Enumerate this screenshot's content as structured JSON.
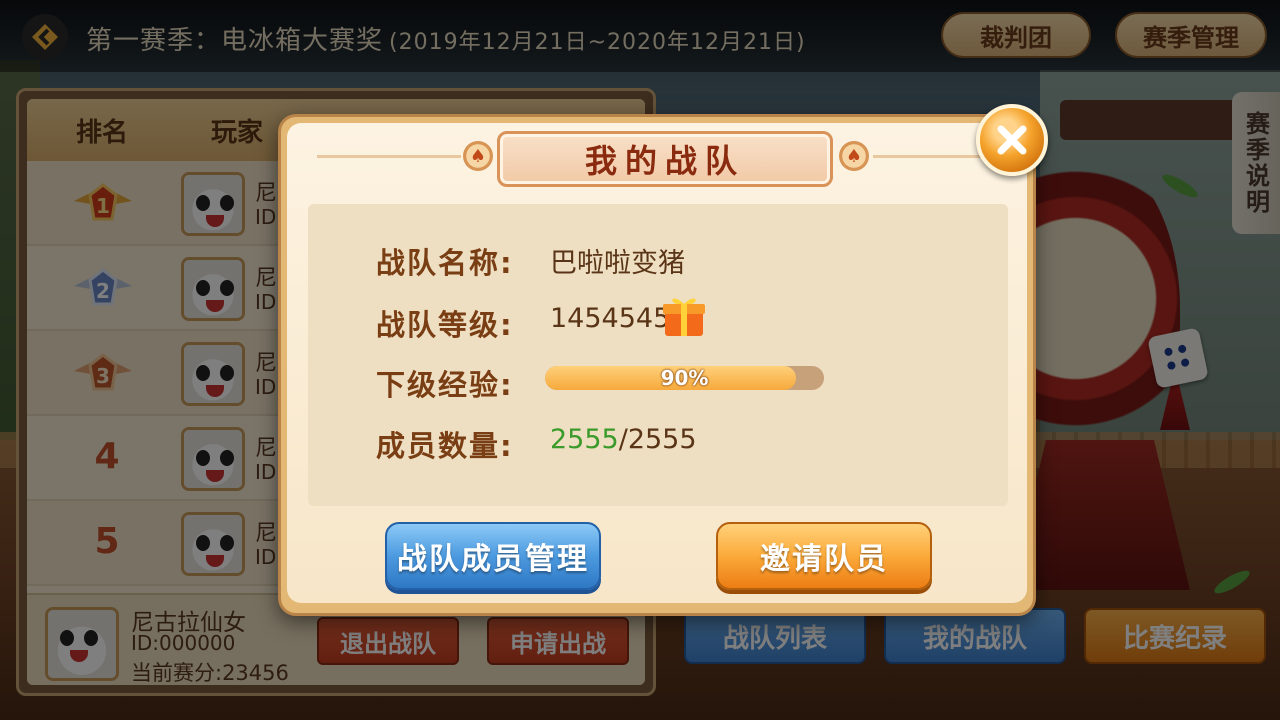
{
  "header": {
    "season_title": "第一赛季：电冰箱大赛奖",
    "season_dates": "(2019年12月21日~2020年12月21日)",
    "judges_label": "裁判团",
    "season_mgmt_label": "赛季管理"
  },
  "side_tab": {
    "label": "赛季说明"
  },
  "ranking": {
    "col_rank": "排名",
    "col_player": "玩家",
    "rows": [
      {
        "rank": "1",
        "name": "尼",
        "id": "ID:"
      },
      {
        "rank": "2",
        "name": "尼",
        "id": "ID:"
      },
      {
        "rank": "3",
        "name": "尼",
        "id": "ID:"
      },
      {
        "rank": "4",
        "name": "尼",
        "id": "ID:"
      },
      {
        "rank": "5",
        "name": "尼",
        "id": "ID:"
      }
    ],
    "me": {
      "name": "尼古拉仙女",
      "id": "ID:000000",
      "score": "当前赛分:23456"
    },
    "quit_label": "退出战队",
    "apply_label": "申请出战"
  },
  "bottom_buttons": {
    "team_list": "战队列表",
    "my_team": "我的战队",
    "records": "比赛纪录"
  },
  "modal": {
    "title": "我的战队",
    "team_name_label": "战队名称:",
    "team_name": "巴啦啦变猪",
    "team_level_label": "战队等级:",
    "team_level": "1454545",
    "next_xp_label": "下级经验:",
    "next_xp_percent": 90,
    "next_xp_text": "90%",
    "member_count_label": "成员数量:",
    "member_current": "2555",
    "member_total": "/2555",
    "manage_button": "战队成员管理",
    "invite_button": "邀请队员"
  },
  "colors": {
    "member_current": "#3a9a2a",
    "xp_fill": "#f6a93c",
    "accent_blue": "#4c9ae0",
    "accent_orange": "#fbaa3a"
  },
  "icons": {
    "back": "back-icon",
    "close": "close-icon",
    "gift": "gift-icon",
    "spade": "spade-icon",
    "avatar": "panda-avatar"
  }
}
